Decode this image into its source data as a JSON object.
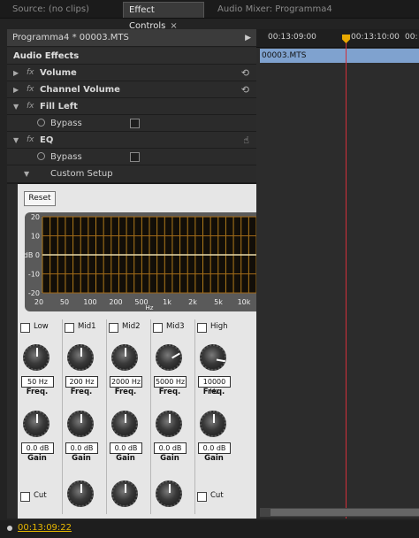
{
  "tabs": [
    {
      "label": "Source: (no clips)"
    },
    {
      "label": "Effect Controls",
      "close": "×"
    },
    {
      "label": "Audio Mixer: Programma4"
    }
  ],
  "clip_header": {
    "title": "Programma4 * 00003.MTS"
  },
  "section_title": "Audio Effects",
  "fx_label": "fx",
  "effects": {
    "volume": "Volume",
    "channel_volume": "Channel Volume",
    "fill_left": "Fill Left",
    "eq": "EQ"
  },
  "params": {
    "bypass": "Bypass",
    "custom_setup": "Custom Setup"
  },
  "eq_panel": {
    "reset_label": "Reset",
    "y_ticks": [
      "20",
      "10",
      "dB 0",
      "-10",
      "-20"
    ],
    "x_ticks": [
      "20",
      "50",
      "100",
      "200",
      "500",
      "1k",
      "2k",
      "5k",
      "10k"
    ],
    "x_unit": "Hz",
    "bands": [
      {
        "name": "Low",
        "freq": "50 Hz",
        "gain": "0.0 dB",
        "cut": "Cut",
        "knob_angle": 0
      },
      {
        "name": "Mid1",
        "freq": "200 Hz",
        "gain": "0.0 dB",
        "cut": "",
        "knob_angle": 0
      },
      {
        "name": "Mid2",
        "freq": "2000 Hz",
        "gain": "0.0 dB",
        "cut": "",
        "knob_angle": 0
      },
      {
        "name": "Mid3",
        "freq": "5000 Hz",
        "gain": "0.0 dB",
        "cut": "",
        "knob_angle": 60
      },
      {
        "name": "High",
        "freq": "10000 Hz",
        "gain": "0.0 dB",
        "cut": "Cut",
        "knob_angle": 100
      }
    ],
    "freq_caption": "Freq.",
    "gain_caption": "Gain"
  },
  "timeline": {
    "timecodes": [
      "00:13:09:00",
      "00:13:10:00",
      "00:"
    ],
    "clip_name": "00003.MTS"
  },
  "footer": {
    "timecode": "00:13:09:22"
  },
  "colors": {
    "clip": "#7fa2cf",
    "playhead": "#e8a800",
    "timecode": "#e8b800"
  }
}
